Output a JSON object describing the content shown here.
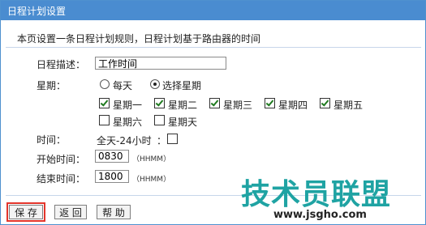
{
  "window": {
    "title": "日程计划设置"
  },
  "description": "本页设置一条日程计划规则，日程计划基于路由器的时间",
  "schedule_desc": {
    "label": "日程描述：",
    "value": "工作时间"
  },
  "week": {
    "label": "星期：",
    "radio_everyday": "每天",
    "radio_select": "选择星期",
    "days": [
      {
        "label": "星期一",
        "checked": true
      },
      {
        "label": "星期二",
        "checked": true
      },
      {
        "label": "星期三",
        "checked": true
      },
      {
        "label": "星期四",
        "checked": true
      },
      {
        "label": "星期五",
        "checked": true
      },
      {
        "label": "星期六",
        "checked": false
      },
      {
        "label": "星期天",
        "checked": false
      }
    ]
  },
  "time": {
    "label": "时间：",
    "allday": "全天-24小时"
  },
  "start": {
    "label": "开始时间：",
    "value": "0830",
    "hint": "（HHMM）"
  },
  "end": {
    "label": "结束时间：",
    "value": "1800",
    "hint": "（HHMM）"
  },
  "buttons": {
    "save": "保 存",
    "back": "返 回",
    "help": "帮 助"
  },
  "watermark": {
    "text": "技术员联盟",
    "url": "www.jsgho.com"
  }
}
